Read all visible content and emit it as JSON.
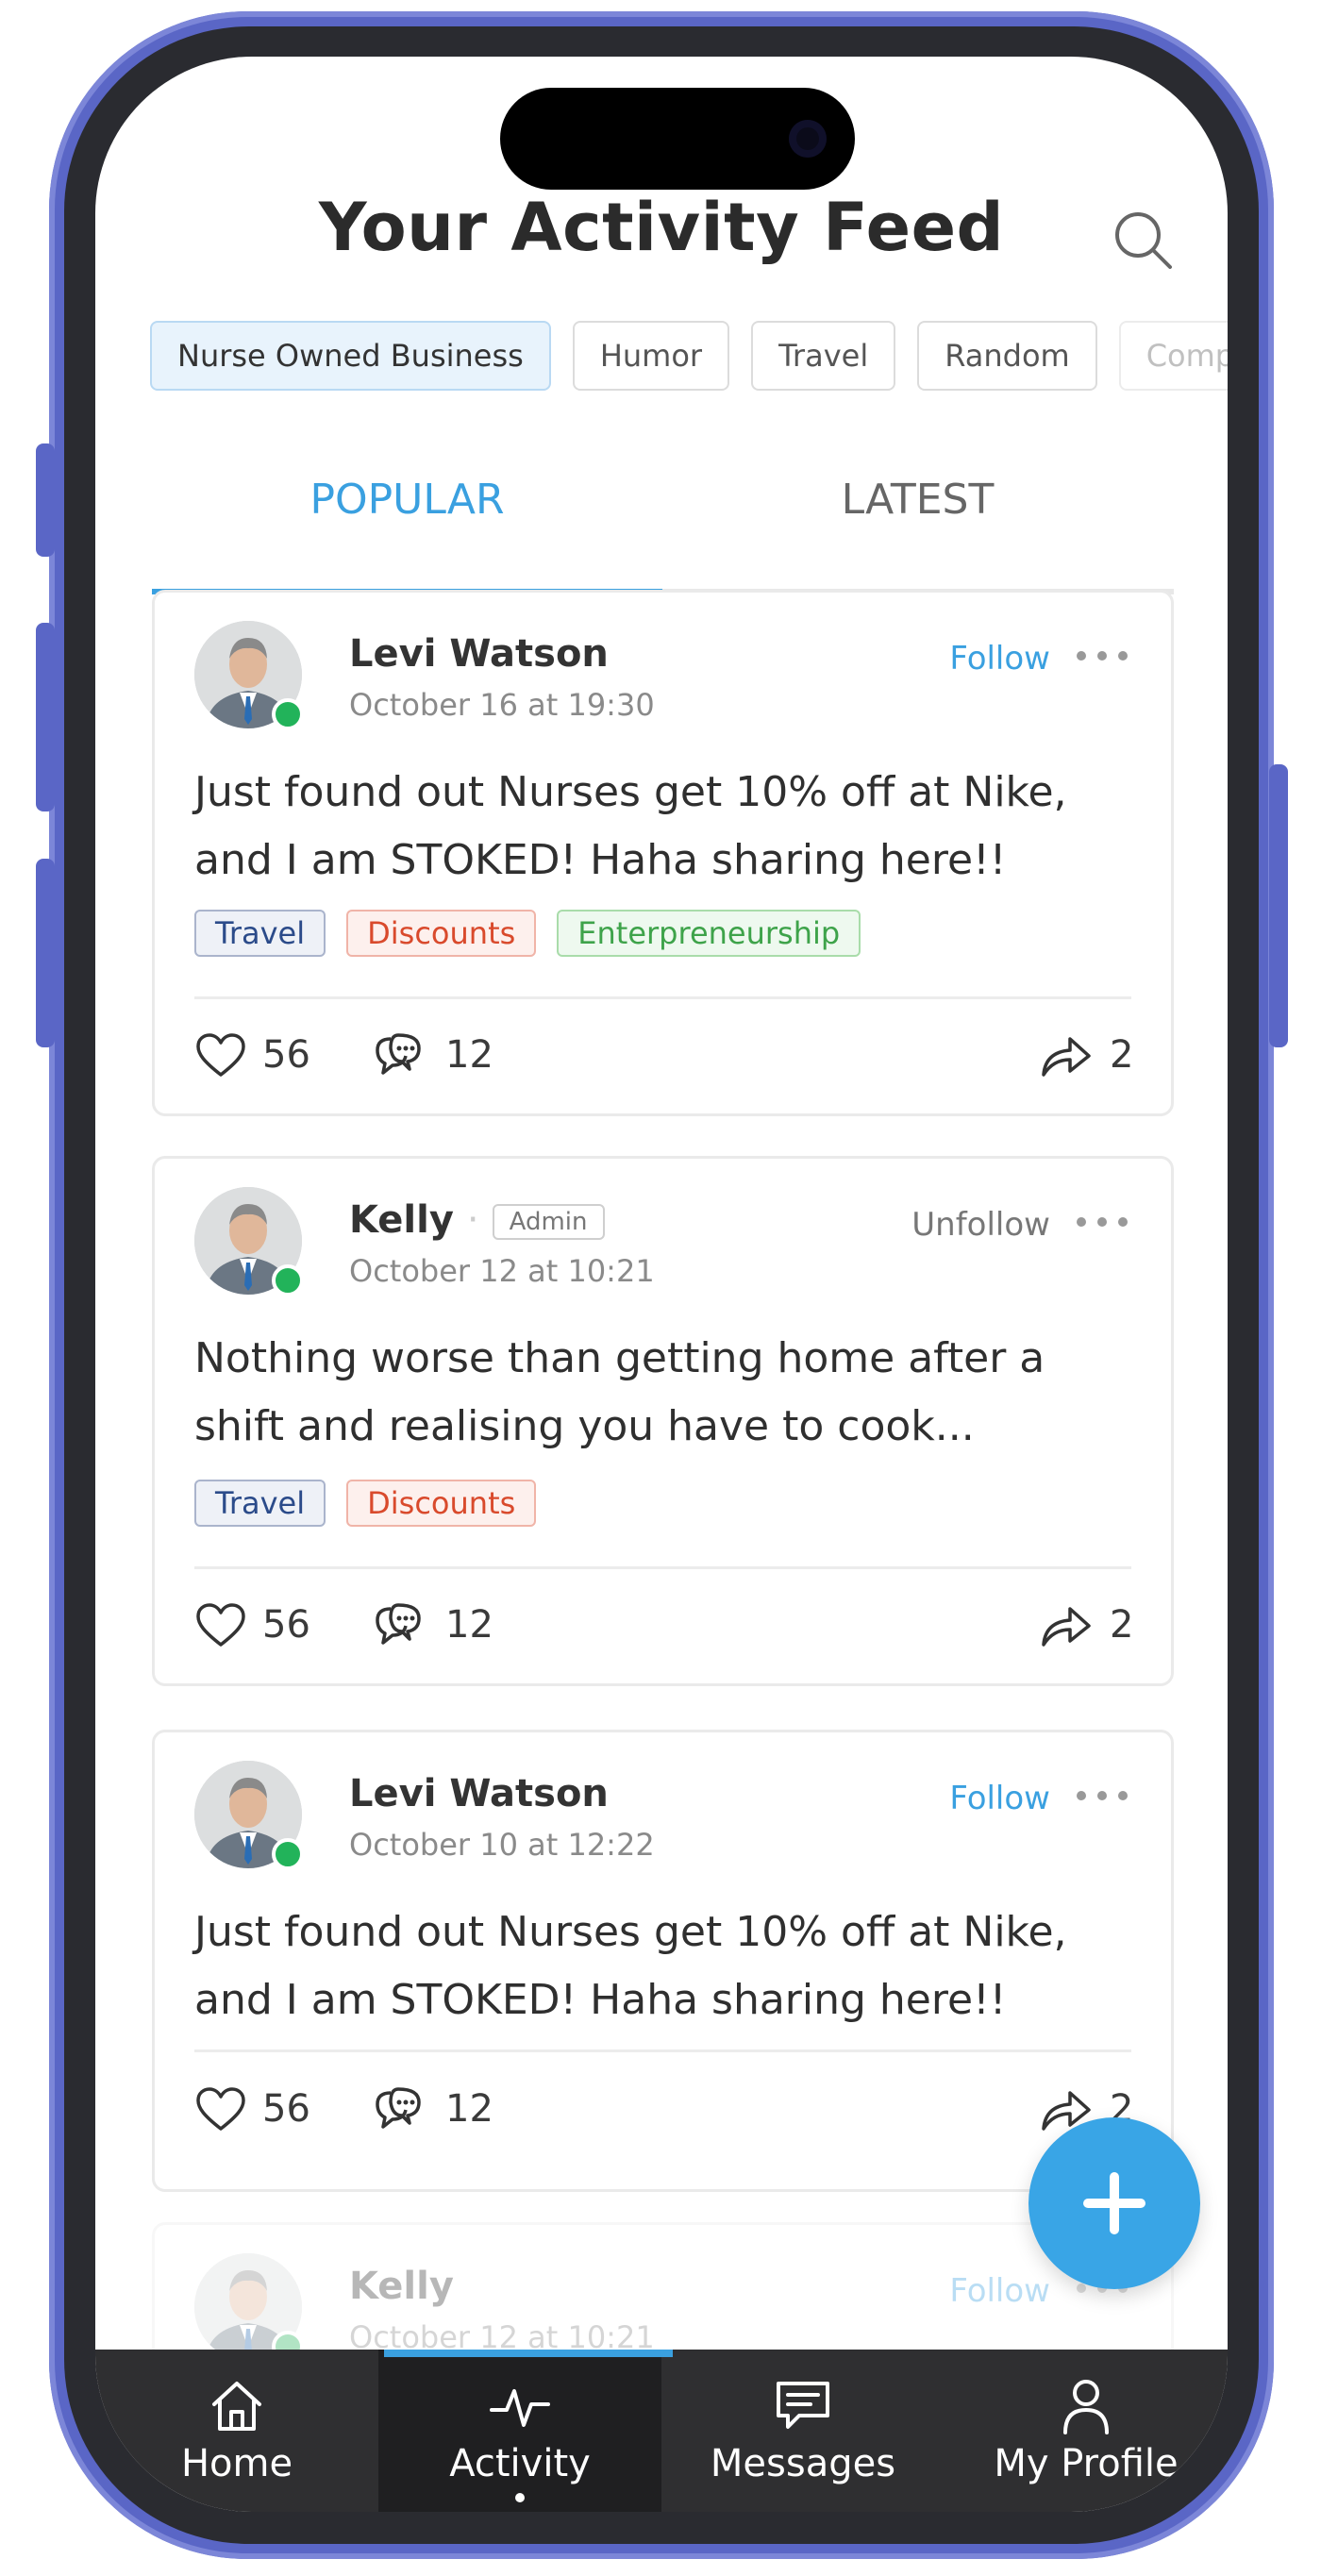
{
  "header": {
    "title": "Your Activity Feed",
    "search_icon": "search-icon"
  },
  "chips": [
    "Nurse Owned Business",
    "Humor",
    "Travel",
    "Random",
    "Compe"
  ],
  "tabs": [
    {
      "label": "POPULAR",
      "active": true
    },
    {
      "label": "LATEST",
      "active": false
    }
  ],
  "posts": [
    {
      "author": "Levi Watson",
      "date": "October 16 at 19:30",
      "action": "Follow",
      "text": "Just found out Nurses get 10% off at Nike, and I am STOKED! Haha sharing here!!",
      "tags": [
        "Travel",
        "Discounts",
        "Enterpreneurship"
      ],
      "likes": "56",
      "comments": "12",
      "shares": "2"
    },
    {
      "author": "Kelly",
      "badge": "Admin",
      "date": "October 12  at 10:21",
      "action": "Unfollow",
      "text": "Nothing worse than getting home after a shift and realising you have to cook...",
      "tags": [
        "Travel",
        "Discounts"
      ],
      "likes": "56",
      "comments": "12",
      "shares": "2"
    },
    {
      "author": "Levi Watson",
      "date": "October 10 at 12:22",
      "action": "Follow",
      "text": "Just found out Nurses get 10% off at Nike, and I am STOKED! Haha sharing here!!",
      "likes": "56",
      "comments": "12",
      "shares": "2"
    },
    {
      "author": "Kelly",
      "date": "October 12  at 10:21",
      "action": "Follow"
    }
  ],
  "nav": [
    {
      "label": "Home",
      "icon": "home-icon"
    },
    {
      "label": "Activity",
      "icon": "activity-icon",
      "active": true
    },
    {
      "label": "Messages",
      "icon": "messages-icon"
    },
    {
      "label": "My Profile",
      "icon": "profile-icon"
    }
  ],
  "colors": {
    "accent": "#3aa0e0",
    "online": "#22b35a",
    "frame": "#5a66c6",
    "navbar": "#2f2f31"
  }
}
